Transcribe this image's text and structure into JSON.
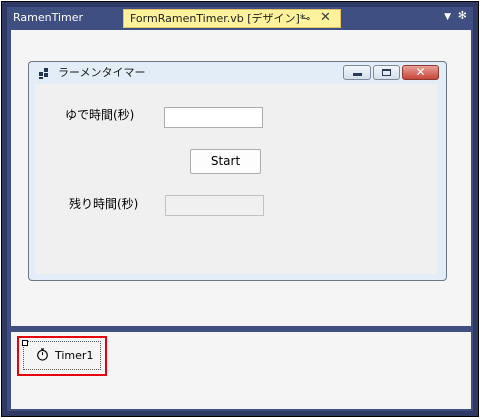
{
  "tabs": [
    {
      "label": "RamenTimer",
      "active": false
    },
    {
      "label": "FormRamenTimer.vb [デザイン]*",
      "active": true
    }
  ],
  "tab_icons": {
    "pin": "pin-icon",
    "close": "close-icon",
    "dropdown": "dropdown-icon",
    "settings": "gear-icon"
  },
  "form": {
    "title": "ラーメンタイマー",
    "boil_time_label": "ゆで時間(秒)",
    "boil_time_value": "",
    "start_label": "Start",
    "remaining_label": "残り時間(秒)",
    "remaining_value": ""
  },
  "component_tray": {
    "items": [
      {
        "label": "Timer1",
        "icon": "stopwatch-icon",
        "highlighted": true
      }
    ]
  },
  "colors": {
    "active_tab": "#fff29d",
    "frame": "#3f4f82",
    "highlight": "#e5000c"
  }
}
